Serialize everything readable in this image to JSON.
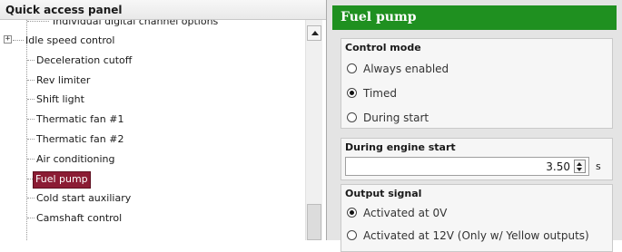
{
  "quick_access": {
    "title": "Quick access panel",
    "items": [
      {
        "label": "Individual digital channel options"
      },
      {
        "label": "Idle speed control",
        "expander": "+"
      },
      {
        "label": "Deceleration cutoff"
      },
      {
        "label": "Rev limiter"
      },
      {
        "label": "Shift light"
      },
      {
        "label": "Thermatic fan #1"
      },
      {
        "label": "Thermatic fan #2"
      },
      {
        "label": "Air conditioning"
      },
      {
        "label": "Fuel pump",
        "selected": true
      },
      {
        "label": "Cold start auxiliary"
      },
      {
        "label": "Camshaft control"
      }
    ]
  },
  "fuel_pump": {
    "title": "Fuel pump",
    "control_mode": {
      "title": "Control mode",
      "options": [
        "Always enabled",
        "Timed",
        "During start"
      ],
      "selected": "Timed"
    },
    "engine_start": {
      "title": "During engine start",
      "value": "3.50",
      "unit": "s"
    },
    "output_signal": {
      "title": "Output signal",
      "options": [
        "Activated at 0V",
        "Activated at 12V (Only w/ Yellow outputs)"
      ],
      "selected": "Activated at 0V"
    }
  },
  "colors": {
    "header_green": "#1f9020",
    "selected_bg": "#8b1c34"
  }
}
